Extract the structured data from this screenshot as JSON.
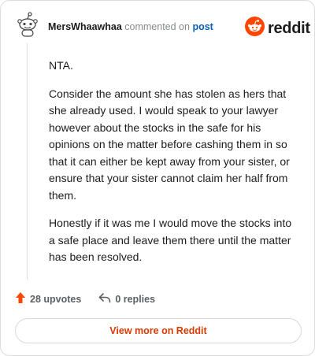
{
  "comment": {
    "username": "MersWhaawhaa",
    "commented_on_text": "commented on",
    "post_link": "post",
    "paragraphs": [
      "NTA.",
      "Consider the amount she has stolen as hers that she already used. I would speak to your lawyer however about the stocks in the safe for his opinions on the matter before cashing them in so that it can either be kept away from your sister, or ensure that your sister cannot claim her half from them.",
      "Honestly if it was me I would move the stocks into a safe place and leave them there until the matter has been resolved."
    ]
  },
  "logo": {
    "wordmark": "reddit",
    "icon": "reddit-snoo-icon"
  },
  "avatar": {
    "icon": "snoo-avatar-icon"
  },
  "actions": {
    "upvotes_label": "28 upvotes",
    "upvote_icon": "upvote-arrow-icon",
    "replies_label": "0 replies",
    "reply_icon": "reply-arrow-icon"
  },
  "view_more_label": "View more on Reddit",
  "colors": {
    "brand_orange": "#ff4500",
    "link_blue": "#0b5fb6",
    "view_more_text": "#d93a00"
  }
}
